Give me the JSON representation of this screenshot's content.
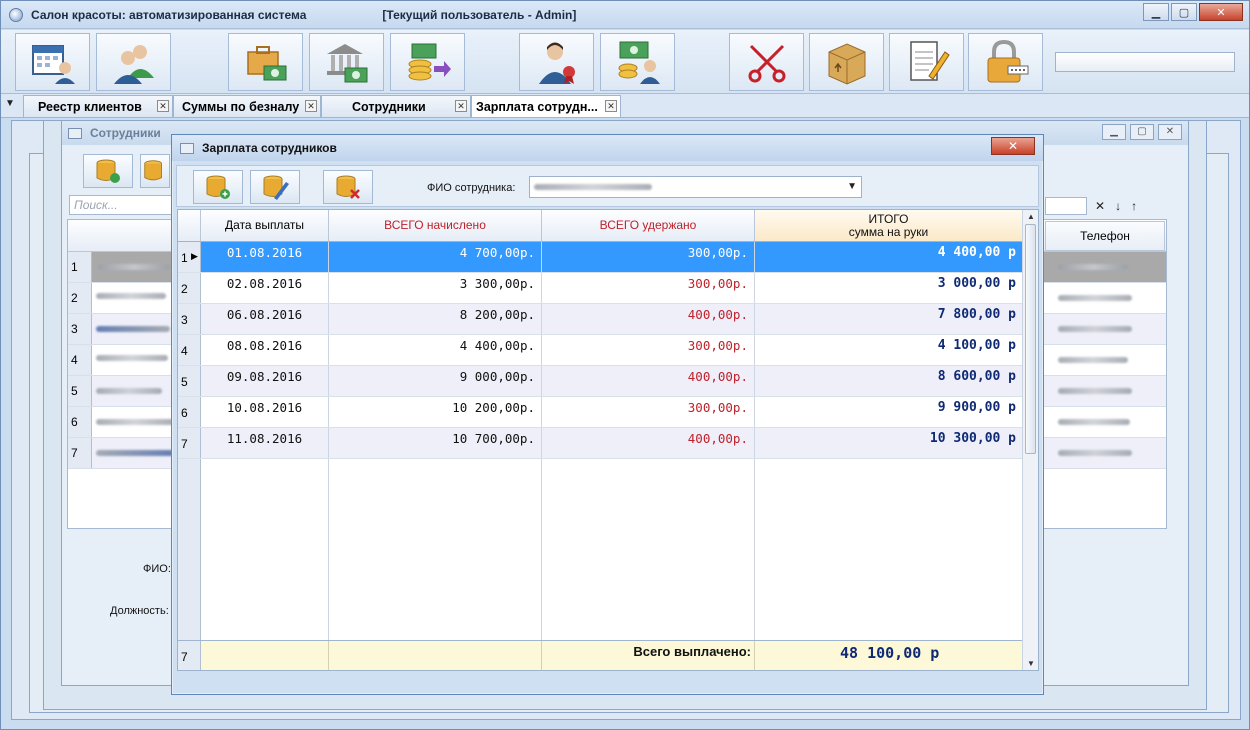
{
  "window": {
    "title": "Салон красоты: автоматизированная система",
    "current_user": "[Текущий пользователь - Admin]",
    "minimize": "▁",
    "maximize": "▢",
    "close": "✕"
  },
  "toolbar": {
    "buttons": [
      {
        "name": "calendar-client-icon"
      },
      {
        "name": "clients-icon"
      },
      {
        "name": "briefcase-money-icon"
      },
      {
        "name": "bank-money-icon"
      },
      {
        "name": "money-transfer-icon"
      },
      {
        "name": "employee-award-icon"
      },
      {
        "name": "salary-icon"
      },
      {
        "name": "scissors-icon"
      },
      {
        "name": "box-icon"
      },
      {
        "name": "notepad-icon"
      },
      {
        "name": "lock-icon"
      }
    ]
  },
  "tabs": [
    {
      "label": "Реестр клиентов"
    },
    {
      "label": "Суммы по безналу"
    },
    {
      "label": "Сотрудники"
    },
    {
      "label": "Зарплата сотрудн..."
    }
  ],
  "background": {
    "window_title": "Сотрудники",
    "search_placeholder": "Поиск...",
    "phone_header": "Телефон",
    "fio_label": "ФИО:",
    "position_label": "Должность:",
    "row_numbers": [
      "1",
      "2",
      "3",
      "4",
      "5",
      "6",
      "7"
    ]
  },
  "dialog": {
    "title": "Зарплата сотрудников",
    "close": "✕",
    "fio_label": "ФИО сотрудника:",
    "dropdown_arrow": "▼",
    "columns": {
      "date": "Дата выплаты",
      "accrued": "ВСЕГО начислено",
      "deducted": "ВСЕГО удержано",
      "total_line1": "ИТОГО",
      "total_line2": "сумма на руки"
    },
    "rows": [
      {
        "num": "1",
        "date": "01.08.2016",
        "accrued": "4 700,00р.",
        "deducted": "300,00р.",
        "total": "4 400,00 р"
      },
      {
        "num": "2",
        "date": "02.08.2016",
        "accrued": "3 300,00р.",
        "deducted": "300,00р.",
        "total": "3 000,00 р"
      },
      {
        "num": "3",
        "date": "06.08.2016",
        "accrued": "8 200,00р.",
        "deducted": "400,00р.",
        "total": "7 800,00 р"
      },
      {
        "num": "4",
        "date": "08.08.2016",
        "accrued": "4 400,00р.",
        "deducted": "300,00р.",
        "total": "4 100,00 р"
      },
      {
        "num": "5",
        "date": "09.08.2016",
        "accrued": "9 000,00р.",
        "deducted": "400,00р.",
        "total": "8 600,00 р"
      },
      {
        "num": "6",
        "date": "10.08.2016",
        "accrued": "10 200,00р.",
        "deducted": "300,00р.",
        "total": "9 900,00 р"
      },
      {
        "num": "7",
        "date": "11.08.2016",
        "accrued": "10 700,00р.",
        "deducted": "400,00р.",
        "total": "10 300,00 р"
      }
    ],
    "footer": {
      "count": "7",
      "label": "Всего выплачено:",
      "value": "48 100,00 р"
    }
  },
  "colors": {
    "selected_row": "#3399ff",
    "deducted_text": "#c0212b",
    "total_text": "#0f2a73",
    "footer_bg": "#fcf8d8"
  }
}
